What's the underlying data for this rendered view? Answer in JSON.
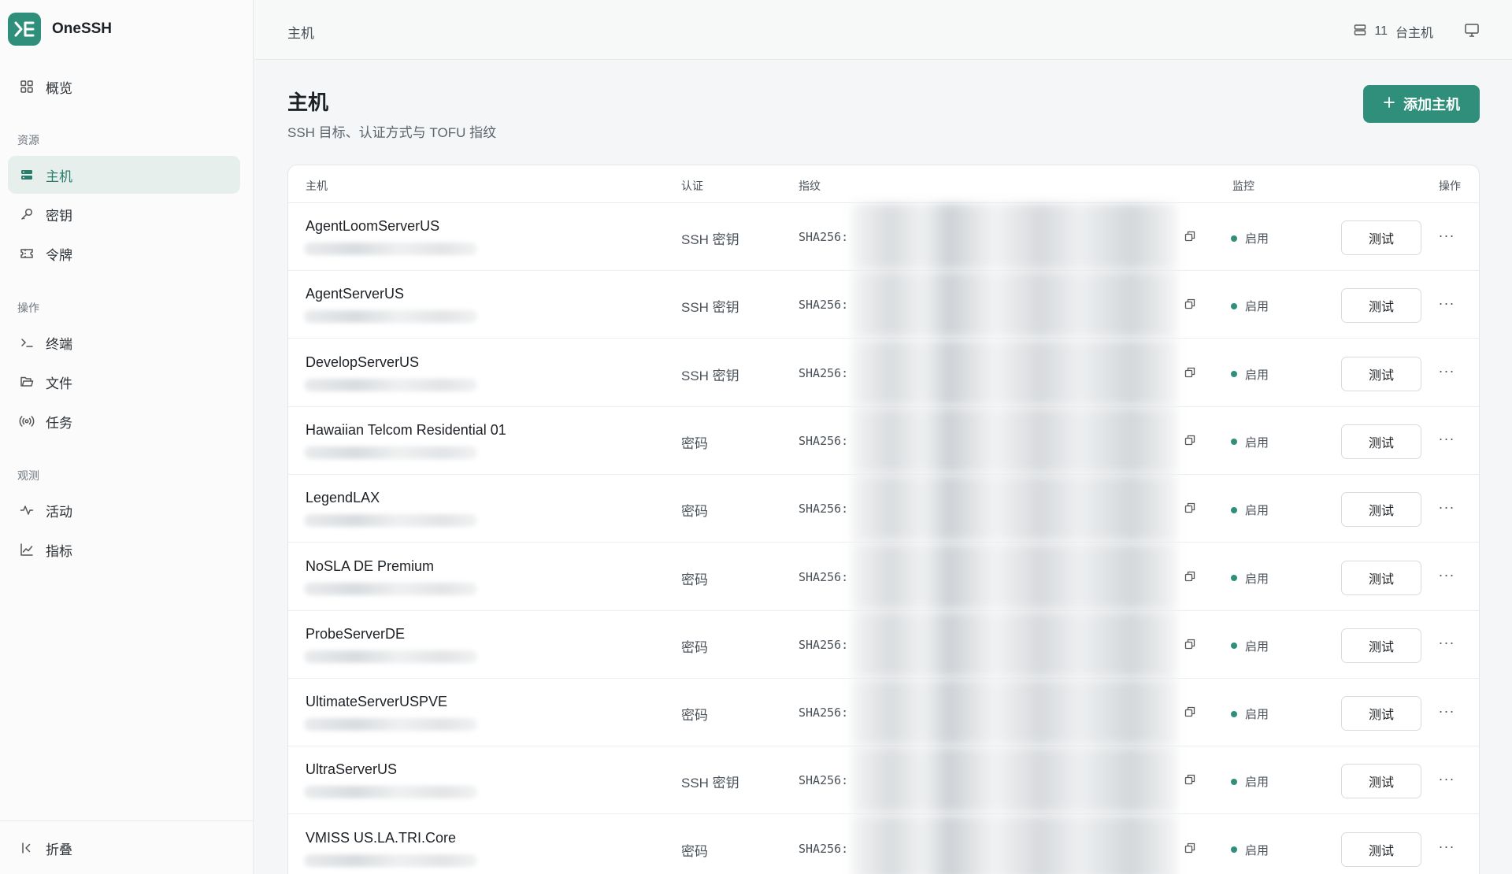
{
  "app": {
    "name": "OneSSH"
  },
  "sidebar": {
    "overview": "概览",
    "sections": {
      "resources": "资源",
      "operations": "操作",
      "observe": "观测"
    },
    "items": {
      "hosts": "主机",
      "keys": "密钥",
      "tokens": "令牌",
      "terminal": "终端",
      "files": "文件",
      "tasks": "任务",
      "activity": "活动",
      "metrics": "指标"
    },
    "collapse": "折叠"
  },
  "topbar": {
    "breadcrumb": "主机",
    "host_count": "11",
    "host_count_unit": "台主机"
  },
  "page": {
    "title": "主机",
    "subtitle": "SSH 目标、认证方式与 TOFU 指纹",
    "add_button": "添加主机"
  },
  "table": {
    "headers": {
      "host": "主机",
      "auth": "认证",
      "fingerprint": "指纹",
      "monitor": "监控",
      "actions": "操作"
    },
    "fingerprint_prefix": "SHA256:",
    "test_label": "测试",
    "more_label": "···",
    "rows": [
      {
        "name": "AgentLoomServerUS",
        "auth": "SSH 密钥",
        "status": "启用"
      },
      {
        "name": "AgentServerUS",
        "auth": "SSH 密钥",
        "status": "启用"
      },
      {
        "name": "DevelopServerUS",
        "auth": "SSH 密钥",
        "status": "启用"
      },
      {
        "name": "Hawaiian Telcom Residential 01",
        "auth": "密码",
        "status": "启用"
      },
      {
        "name": "LegendLAX",
        "auth": "密码",
        "status": "启用"
      },
      {
        "name": "NoSLA DE Premium",
        "auth": "密码",
        "status": "启用"
      },
      {
        "name": "ProbeServerDE",
        "auth": "密码",
        "status": "启用"
      },
      {
        "name": "UltimateServerUSPVE",
        "auth": "密码",
        "status": "启用"
      },
      {
        "name": "UltraServerUS",
        "auth": "SSH 密钥",
        "status": "启用"
      },
      {
        "name": "VMISS US.LA.TRI.Core",
        "auth": "密码",
        "status": "启用"
      }
    ]
  },
  "colors": {
    "accent": "#2f8f7b",
    "active_bg": "#e7efec"
  }
}
